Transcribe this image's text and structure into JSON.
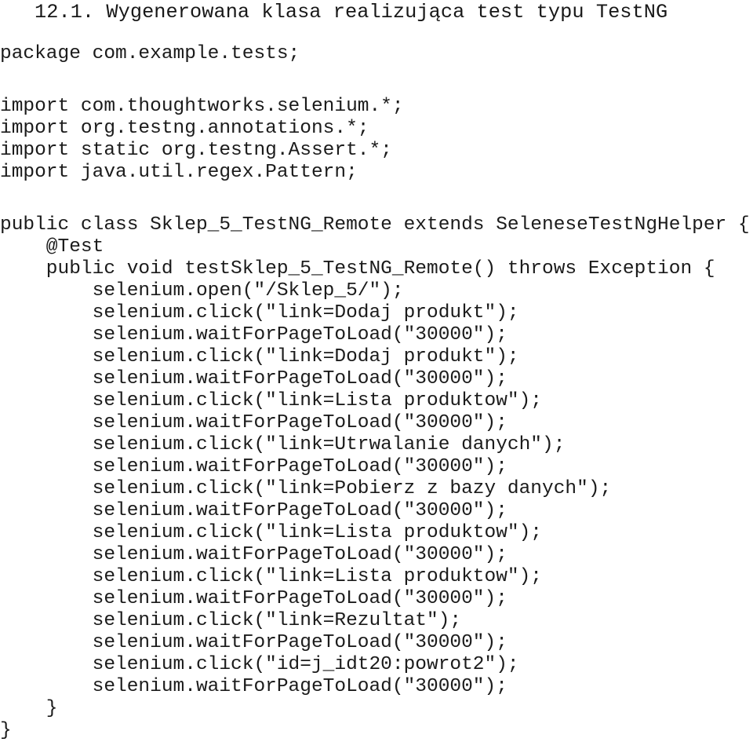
{
  "document": {
    "heading": "12.1. Wygenerowana klasa realizująca test typu TestNG",
    "language": "java",
    "text_color": "#1b1b1b",
    "background_color": "#ffffff"
  },
  "code": {
    "package_line": "package com.example.tests;",
    "imports": [
      "import com.thoughtworks.selenium.*;",
      "import org.testng.annotations.*;",
      "import static org.testng.Assert.*;",
      "import java.util.regex.Pattern;"
    ],
    "class_declaration": "public class Sklep_5_TestNG_Remote extends SeleneseTestNgHelper {",
    "annotation": "    @Test",
    "method_declaration": "    public void testSklep_5_TestNG_Remote() throws Exception {",
    "body": [
      "        selenium.open(\"/Sklep_5/\");",
      "        selenium.click(\"link=Dodaj produkt\");",
      "        selenium.waitForPageToLoad(\"30000\");",
      "        selenium.click(\"link=Dodaj produkt\");",
      "        selenium.waitForPageToLoad(\"30000\");",
      "        selenium.click(\"link=Lista produktow\");",
      "        selenium.waitForPageToLoad(\"30000\");",
      "        selenium.click(\"link=Utrwalanie danych\");",
      "        selenium.waitForPageToLoad(\"30000\");",
      "        selenium.click(\"link=Pobierz z bazy danych\");",
      "        selenium.waitForPageToLoad(\"30000\");",
      "        selenium.click(\"link=Lista produktow\");",
      "        selenium.waitForPageToLoad(\"30000\");",
      "        selenium.click(\"link=Lista produktow\");",
      "        selenium.waitForPageToLoad(\"30000\");",
      "        selenium.click(\"link=Rezultat\");",
      "        selenium.waitForPageToLoad(\"30000\");",
      "        selenium.click(\"id=j_idt20:powrot2\");",
      "        selenium.waitForPageToLoad(\"30000\");"
    ],
    "method_close": "    }",
    "class_close": "}"
  }
}
